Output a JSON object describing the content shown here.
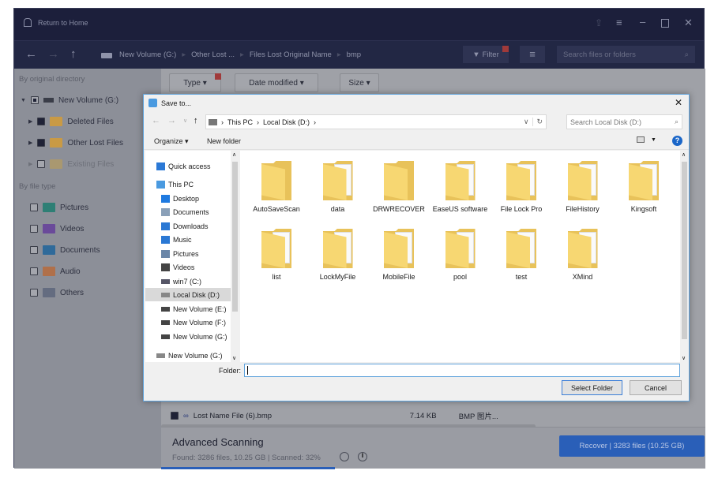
{
  "app": {
    "return_home": "Return to Home",
    "breadcrumb": [
      "New Volume (G:)",
      "Other Lost ...",
      "Files Lost Original Name",
      "bmp"
    ],
    "filter_label": "Filter",
    "search_placeholder": "Search files or folders",
    "filters": [
      "Type",
      "Date modified",
      "Size"
    ],
    "sidebar": {
      "section_dir": "By original directory",
      "tree": [
        {
          "label": "New Volume (G:)",
          "state": "partial"
        },
        {
          "label": "Deleted Files",
          "state": "checked"
        },
        {
          "label": "Other Lost Files",
          "state": "checked"
        },
        {
          "label": "Existing Files",
          "state": "unchecked"
        }
      ],
      "section_type": "By file type",
      "types": [
        {
          "label": "Pictures",
          "color": "#2e9a8a"
        },
        {
          "label": "Videos",
          "color": "#7a4cb8"
        },
        {
          "label": "Documents",
          "color": "#2f7fc0"
        },
        {
          "label": "Audio",
          "color": "#e07a3a"
        },
        {
          "label": "Others",
          "color": "#6a7590"
        }
      ]
    },
    "file_row": {
      "name": "Lost Name File (6).bmp",
      "size": "7.14 KB",
      "type": "BMP 图片..."
    },
    "scan": {
      "title": "Advanced Scanning",
      "status": "Found: 3286 files, 10.25 GB | Scanned: 32%",
      "progress_percent": 32
    },
    "recover_label": "Recover | 3283 files (10.25 GB)",
    "accent": "#2f6fd0"
  },
  "dialog": {
    "title": "Save to...",
    "path": [
      "This PC",
      "Local Disk (D:)"
    ],
    "search_placeholder": "Search Local Disk (D:)",
    "organize": "Organize ▾",
    "new_folder": "New folder",
    "nav": [
      "Quick access",
      "This PC",
      "Desktop",
      "Documents",
      "Downloads",
      "Music",
      "Pictures",
      "Videos",
      "win7 (C:)",
      "Local Disk (D:)",
      "New Volume (E:)",
      "New Volume (F:)",
      "New Volume (G:)",
      "New Volume (G:)"
    ],
    "selected_nav": "Local Disk (D:)",
    "folders": [
      "AutoSaveScan",
      "data",
      "DRWRECOVER",
      "EaseUS software",
      "File Lock Pro",
      "FileHistory",
      "Kingsoft",
      "list",
      "LockMyFile",
      "MobileFile",
      "pool",
      "test",
      "XMind"
    ],
    "folder_label": "Folder:",
    "folder_value": "",
    "select_button": "Select Folder",
    "cancel_button": "Cancel"
  }
}
